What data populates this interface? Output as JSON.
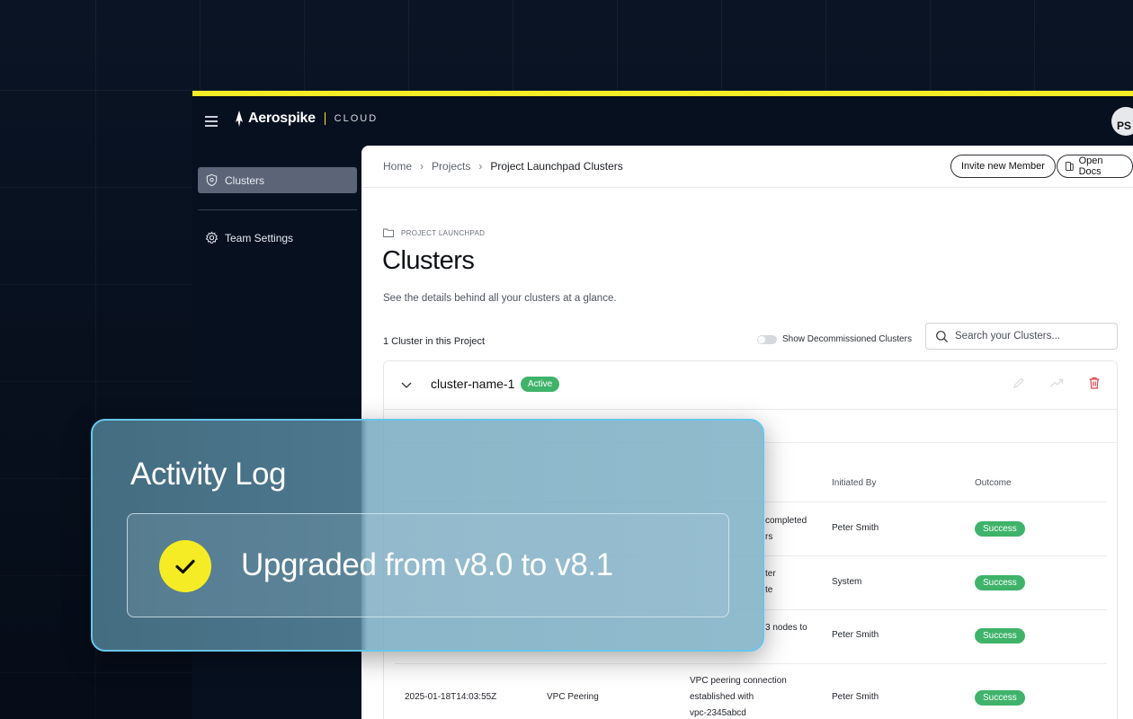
{
  "brand": {
    "name": "Aerospike",
    "sub": "CLOUD",
    "accent": "#f5ec25"
  },
  "user": {
    "initials": "PS"
  },
  "sidebar": {
    "items": [
      {
        "label": "Clusters",
        "icon": "cluster-shield-icon"
      },
      {
        "label": "Team Settings",
        "icon": "gear-icon"
      }
    ]
  },
  "breadcrumb": {
    "home": "Home",
    "projects": "Projects",
    "current": "Project Launchpad Clusters"
  },
  "header": {
    "invite_label": "Invite new Member",
    "docs_label": "Open Docs"
  },
  "page": {
    "eyebrow": "PROJECT LAUNCHPAD",
    "title": "Clusters",
    "subtitle": "See the details behind all your clusters at a glance.",
    "count": "1 Cluster in this Project",
    "toggle_label": "Show Decommissioned Clusters",
    "search_placeholder": "Search your Clusters..."
  },
  "cluster": {
    "name": "cluster-name-1",
    "status": "Active",
    "status_color": "#3fb36a"
  },
  "activity_table": {
    "columns": [
      "Initiated By",
      "Outcome"
    ],
    "rows": [
      {
        "desc_l1": "completed",
        "desc_l2": "rs",
        "initiated_by": "Peter Smith",
        "outcome": "Success"
      },
      {
        "desc_l1": "ter",
        "desc_l2": "te",
        "initiated_by": "System",
        "outcome": "Success"
      },
      {
        "desc_l1": "3 nodes to",
        "desc_l2": "",
        "initiated_by": "Peter Smith",
        "outcome": "Success"
      },
      {
        "timestamp": "2025-01-18T14:03:55Z",
        "type": "VPC Peering",
        "desc_l1": "VPC peering connection",
        "desc_l2": "established with",
        "desc_l3": "vpc-2345abcd",
        "initiated_by": "Peter Smith",
        "outcome": "Success"
      }
    ]
  },
  "overlay": {
    "title": "Activity Log",
    "message": "Upgraded from v8.0 to v8.1",
    "check_color": "#f5ec25"
  }
}
